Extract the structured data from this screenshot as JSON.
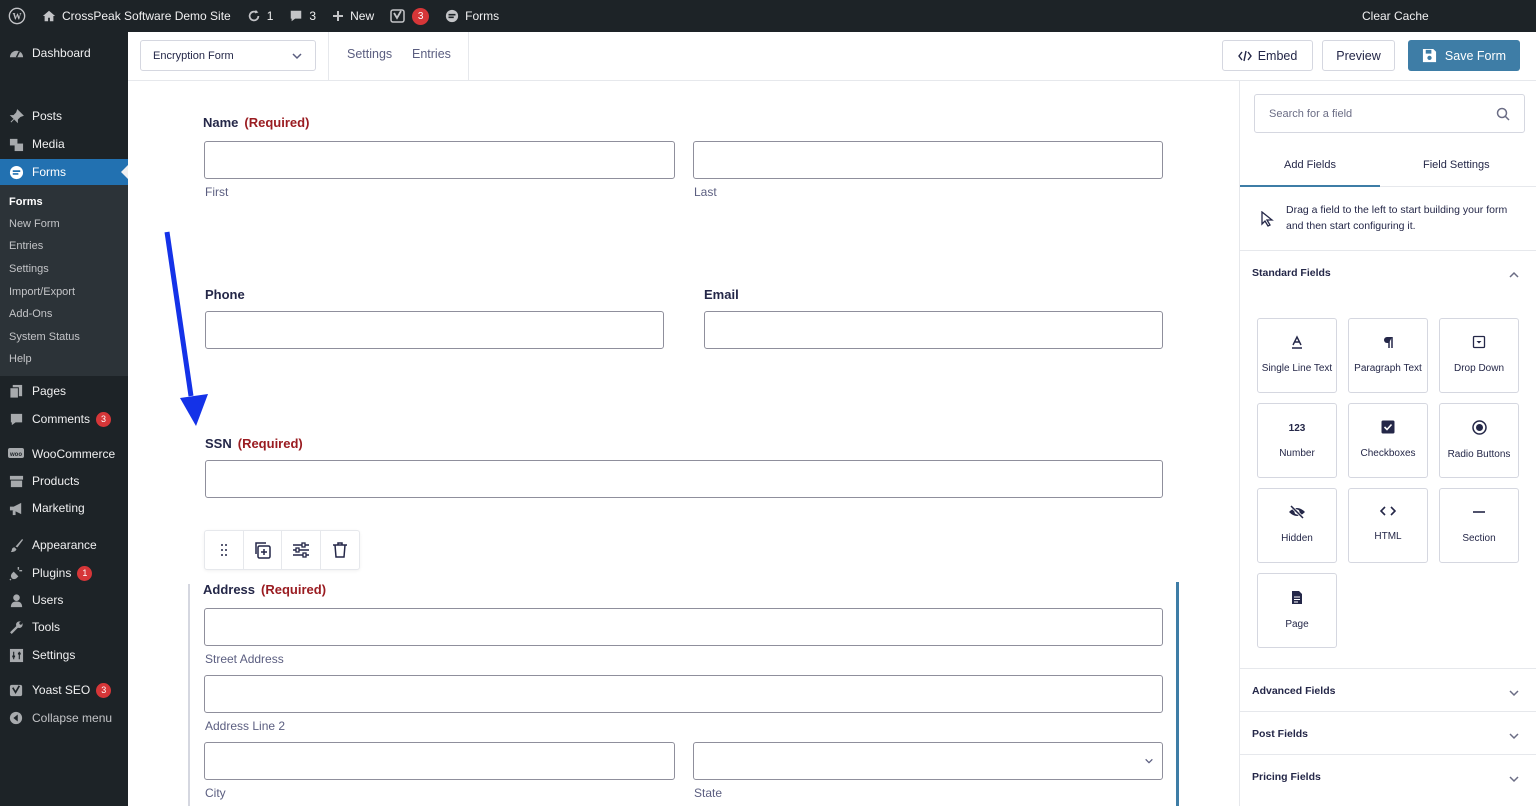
{
  "adminbar": {
    "site_name": "CrossPeak Software Demo Site",
    "updates_count": "1",
    "comments_count": "3",
    "new_label": "New",
    "yoast_badge": "3",
    "forms_label": "Forms",
    "clear_cache": "Clear Cache"
  },
  "sidebar": {
    "dashboard": "Dashboard",
    "posts": "Posts",
    "media": "Media",
    "forms": "Forms",
    "submenu": [
      "Forms",
      "New Form",
      "Entries",
      "Settings",
      "Import/Export",
      "Add-Ons",
      "System Status",
      "Help"
    ],
    "pages": "Pages",
    "comments": "Comments",
    "comments_badge": "3",
    "woocommerce": "WooCommerce",
    "products": "Products",
    "marketing": "Marketing",
    "appearance": "Appearance",
    "plugins": "Plugins",
    "plugins_badge": "1",
    "users": "Users",
    "tools": "Tools",
    "settings": "Settings",
    "yoast": "Yoast SEO",
    "yoast_badge": "3",
    "collapse": "Collapse menu"
  },
  "toolbar": {
    "form_selector": "Encryption Form",
    "settings": "Settings",
    "entries": "Entries",
    "embed": "Embed",
    "preview": "Preview",
    "save": "Save Form"
  },
  "form": {
    "required": "(Required)",
    "name_label": "Name",
    "first": "First",
    "last": "Last",
    "phone_label": "Phone",
    "email_label": "Email",
    "ssn_label": "SSN",
    "address_label": "Address",
    "street": "Street Address",
    "line2": "Address Line 2",
    "city": "City",
    "state": "State"
  },
  "panel": {
    "search_placeholder": "Search for a field",
    "tab_add": "Add Fields",
    "tab_settings": "Field Settings",
    "help": "Drag a field to the left to start building your form and then start configuring it.",
    "standard_title": "Standard Fields",
    "fields": [
      "Single Line Text",
      "Paragraph Text",
      "Drop Down",
      "Number",
      "Checkboxes",
      "Radio Buttons",
      "Hidden",
      "HTML",
      "Section",
      "Page"
    ],
    "advanced_title": "Advanced Fields",
    "post_title": "Post Fields",
    "pricing_title": "Pricing Fields"
  },
  "colors": {
    "admin_dark": "#1d2327",
    "accent": "#2271b1",
    "save_button": "#3e7da6",
    "required": "#9a1c21",
    "annotation_arrow": "#1432e8"
  }
}
